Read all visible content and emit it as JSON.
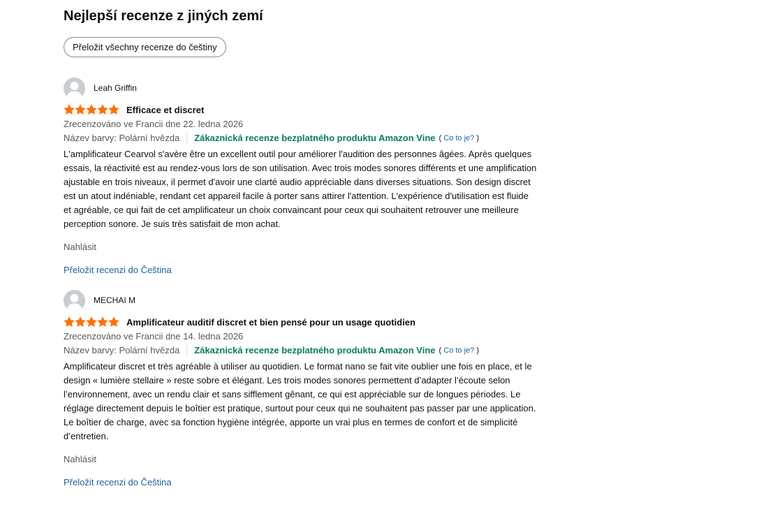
{
  "section": {
    "title": "Nejlepší recenze z jiných zemí",
    "translate_all_label": "Přeložit všechny recenze do češtiny"
  },
  "colors": {
    "star": "#ff6f00",
    "vine": "#067d62",
    "link": "#2162a1",
    "muted": "#565959"
  },
  "reviews": [
    {
      "author": "Leah Griffin",
      "rating": 5,
      "title": "Efficace et discret",
      "date": "Zrecenzováno ve Francii dne 22. ledna 2026",
      "variant": "Název barvy: Polární hvězda",
      "vine_badge": "Zákaznická recenze bezplatného produktu Amazon Vine",
      "vine_help_open": "(",
      "vine_help_link": "Co to je?",
      "vine_help_close": ")",
      "body": "L'amplificateur Cearvol s'avère être un excellent outil pour améliorer l'audition des personnes âgées. Après quelques essais, la réactivité est au rendez-vous lors de son utilisation. Avec trois modes sonores différents et une amplification ajustable en trois niveaux, il permet d'avoir une clarté audio appréciable dans diverses situations. Son design discret est un atout indéniable, rendant cet appareil facile à porter sans attirer l'attention. L'expérience d'utilisation est fluide et agréable, ce qui fait de cet amplificateur un choix convaincant pour ceux qui souhaitent retrouver une meilleure perception sonore. Je suis très satisfait de mon achat.",
      "report_label": "Nahlásit",
      "translate_label": "Přeložit recenzi do Čeština"
    },
    {
      "author": "MECHAI M",
      "rating": 5,
      "title": "Amplificateur auditif discret et bien pensé pour un usage quotidien",
      "date": "Zrecenzováno ve Francii dne 14. ledna 2026",
      "variant": "Název barvy: Polární hvězda",
      "vine_badge": "Zákaznická recenze bezplatného produktu Amazon Vine",
      "vine_help_open": "(",
      "vine_help_link": "Co to je?",
      "vine_help_close": ")",
      "body": "Amplificateur discret et très agréable à utiliser au quotidien. Le format nano se fait vite oublier une fois en place, et le design « lumière stellaire » reste sobre et élégant. Les trois modes sonores permettent d’adapter l’écoute selon l’environnement, avec un rendu clair et sans sifflement gênant, ce qui est appréciable sur de longues périodes. Le réglage directement depuis le boîtier est pratique, surtout pour ceux qui ne souhaitent pas passer par une application. Le boîtier de charge, avec sa fonction hygiène intégrée, apporte un vrai plus en termes de confort et de simplicité d’entretien.",
      "report_label": "Nahlásit",
      "translate_label": "Přeložit recenzi do Čeština"
    }
  ]
}
